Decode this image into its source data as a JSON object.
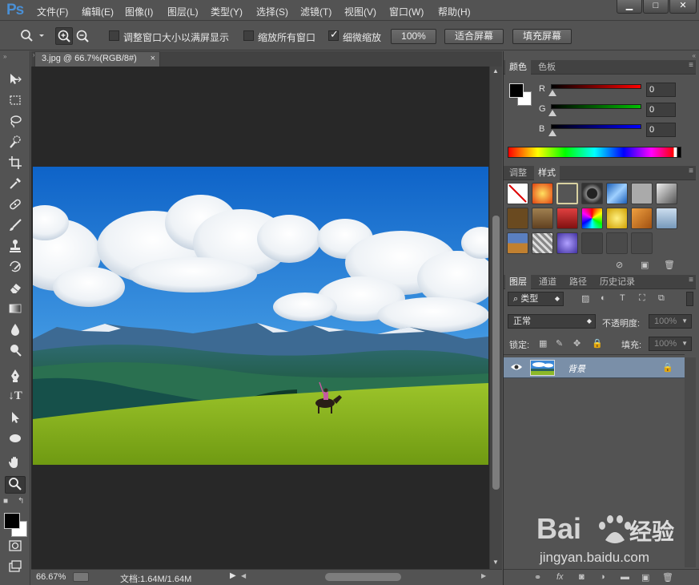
{
  "app": {
    "logo": "Ps"
  },
  "menu": [
    "文件(F)",
    "编辑(E)",
    "图像(I)",
    "图层(L)",
    "类型(Y)",
    "选择(S)",
    "滤镜(T)",
    "视图(V)",
    "窗口(W)",
    "帮助(H)"
  ],
  "window_controls": {
    "minimize": "▁",
    "maximize": "□",
    "close": "✕"
  },
  "options": {
    "resize_windows": {
      "label": "调整窗口大小以满屏显示",
      "checked": false
    },
    "zoom_all": {
      "label": "缩放所有窗口",
      "checked": false
    },
    "scrubby_zoom": {
      "label": "细微缩放",
      "checked": true
    },
    "btn_100": "100%",
    "btn_fit": "适合屏幕",
    "btn_fill": "填充屏幕"
  },
  "document": {
    "tab_title": "3.jpg @ 66.7%(RGB/8#)",
    "close": "×",
    "zoom": "66.67%",
    "doc_info": "文档:1.64M/1.64M"
  },
  "color_panel": {
    "tabs": [
      "颜色",
      "色板"
    ],
    "active_tab": "颜色",
    "channels": [
      {
        "label": "R",
        "value": "0"
      },
      {
        "label": "G",
        "value": "0"
      },
      {
        "label": "B",
        "value": "0"
      }
    ],
    "colors": {
      "r_bar": "#ff0000",
      "g_bar": "#00c000",
      "b_bar": "#0000ff"
    }
  },
  "styles_panel": {
    "tabs": [
      "调整",
      "样式"
    ],
    "active_tab": "样式"
  },
  "layers_panel": {
    "tabs": [
      "图层",
      "通道",
      "路径",
      "历史记录"
    ],
    "active_tab": "图层",
    "filter_label": "类型",
    "blend_mode": "正常",
    "opacity_label": "不透明度:",
    "opacity_value": "100%",
    "lock_label": "锁定:",
    "fill_label": "填充:",
    "fill_value": "100%",
    "layers": [
      {
        "name": "背景",
        "visible": true,
        "locked": true
      }
    ]
  },
  "watermark": {
    "brand": "Baidu经验",
    "url": "jingyan.baidu.com"
  }
}
